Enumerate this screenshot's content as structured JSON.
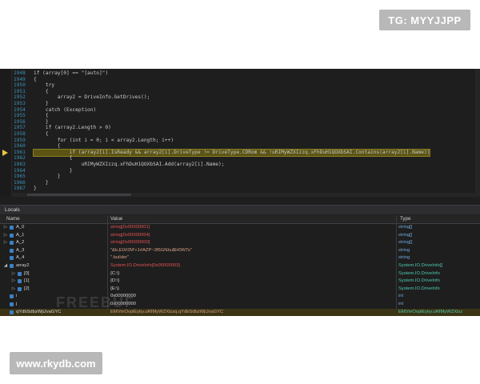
{
  "watermark_top": "TG: MYYJJPP",
  "watermark_bottom": "www.rkydb.com",
  "watermark_center": "FREEBUF",
  "editor": {
    "lines": [
      {
        "num": "1948",
        "code": "if (array[0] == \"[auto]\")"
      },
      {
        "num": "1949",
        "code": "{"
      },
      {
        "num": "1950",
        "code": "    try"
      },
      {
        "num": "1951",
        "code": "    {"
      },
      {
        "num": "1952",
        "code": "        array2 = DriveInfo.GetDrives();"
      },
      {
        "num": "1953",
        "code": "    }"
      },
      {
        "num": "1954",
        "code": "    catch (Exception)"
      },
      {
        "num": "1955",
        "code": "    {"
      },
      {
        "num": "1956",
        "code": "    }"
      },
      {
        "num": "1957",
        "code": "    if (array2.Length > 0)"
      },
      {
        "num": "1958",
        "code": "    {"
      },
      {
        "num": "1959",
        "code": "        for (int i = 0; i < array2.Length; i++)"
      },
      {
        "num": "1960",
        "code": "        {"
      },
      {
        "num": "1961",
        "code": "            if (array2[i].IsReady && array2[i].DriveType != DriveType.CDRom && !uRIMyWZXIzzq.xFhDuH1QOXbSAI.Contains(array2[i].Name))"
      },
      {
        "num": "1962",
        "code": "            {"
      },
      {
        "num": "1963",
        "code": "                uRIMyWZXIzzq.xFhDuH1QOXbSAI.Add(array2[i].Name);"
      },
      {
        "num": "1964",
        "code": "            }"
      },
      {
        "num": "1965",
        "code": "        }"
      },
      {
        "num": "1966",
        "code": "    }"
      },
      {
        "num": "1967",
        "code": "}"
      }
    ]
  },
  "locals": {
    "title": "Locals",
    "columns": {
      "name": "Name",
      "value": "Value",
      "type": "Type"
    },
    "rows": [
      {
        "expander": "▷",
        "name": "A_0",
        "value": "string[0x00000001]",
        "type": "string[]"
      },
      {
        "expander": "▷",
        "name": "A_1",
        "value": "string[0x00000064]",
        "type": "string[]"
      },
      {
        "expander": "▷",
        "name": "A_2",
        "value": "string[0x00000000]",
        "type": "string[]"
      },
      {
        "expander": "",
        "name": "A_3",
        "value": "\"&b,E0#2M'+1#AZP~3f5GNbu$H0WTs\"",
        "type": "string"
      },
      {
        "expander": "",
        "name": "A_4",
        "value": "\".builder\"",
        "type": "string"
      },
      {
        "expander": "◢",
        "name": "array2",
        "value": "System.IO.DriveInfo[0x00000003]",
        "type": "System.IO.DriveInfo[]"
      },
      {
        "expander": "▷",
        "name": "[0]",
        "value": "{C:\\}",
        "type": "System.IO.DriveInfo"
      },
      {
        "expander": "▷",
        "name": "[1]",
        "value": "{D:\\}",
        "type": "System.IO.DriveInfo"
      },
      {
        "expander": "▷",
        "name": "[2]",
        "value": "{E:\\}",
        "type": "System.IO.DriveInfo"
      },
      {
        "expander": "",
        "name": "i",
        "value": "0x00000000",
        "type": "int"
      },
      {
        "expander": "",
        "name": "j",
        "value": "0x00000000",
        "type": "int"
      },
      {
        "expander": "",
        "name": "qYdbSdbzWjiJvaGYC",
        "value": "EMVmOvplEyby.uRIMyWZXlzzq.qYdbSdbzWjiJvaGYC",
        "type": "EMVmOvplEyby.uRIMyWZXlzz"
      }
    ]
  }
}
